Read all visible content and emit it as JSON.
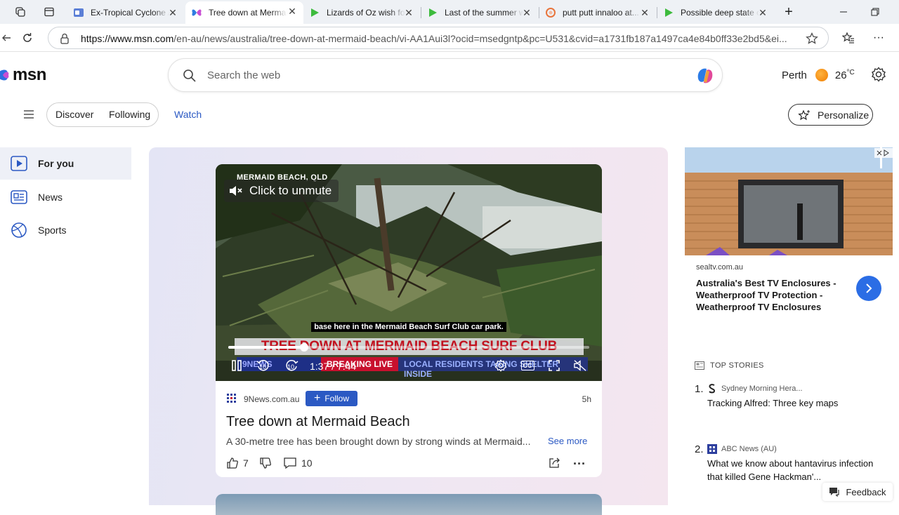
{
  "browser": {
    "tabs": [
      {
        "title": "Ex-Tropical Cyclone A...",
        "icon": "outlook-icon",
        "active": false
      },
      {
        "title": "Tree down at Mermaid Beach",
        "icon": "msn-butterfly-icon",
        "active": true
      },
      {
        "title": "Lizards of Oz wish for...",
        "icon": "play-icon",
        "active": false
      },
      {
        "title": "Last of the summer w...",
        "icon": "play-icon",
        "active": false
      },
      {
        "title": "putt putt innaloo at...",
        "icon": "google-icon",
        "active": false
      },
      {
        "title": "Possible deep state c...",
        "icon": "play-icon",
        "active": false
      }
    ],
    "url_domain": "https://www.msn.com",
    "url_rest": "/en-au/news/australia/tree-down-at-mermaid-beach/vi-AA1Aui3l?ocid=msedgntp&pc=U531&cvid=a1731fb187a1497ca4e84b0ff33e2bd5&ei..."
  },
  "header": {
    "logo": "msn",
    "search_placeholder": "Search the web",
    "location": "Perth",
    "temperature": "26",
    "temp_unit": "°C"
  },
  "nav": {
    "discover": "Discover",
    "following": "Following",
    "watch": "Watch",
    "personalize": "Personalize"
  },
  "sidebar": {
    "items": [
      {
        "label": "For you",
        "icon": "play-square-icon",
        "active": true
      },
      {
        "label": "News",
        "icon": "newspaper-icon",
        "active": false
      },
      {
        "label": "Sports",
        "icon": "ball-icon",
        "active": false
      }
    ]
  },
  "video": {
    "location_chyron": "MERMAID BEACH, QLD",
    "unmute_label": "Click to unmute",
    "caption": "base here in the Mermaid Beach Surf Club car park.",
    "headline": "TREE DOWN AT MERMAID BEACH SURF CLUB",
    "ticker_1": "9NEWS",
    "ticker_2": "BREAKING LIVE",
    "ticker_3": "LOCAL RESIDENTS TAKING SHELTER INSIDE",
    "current_time": "1:37",
    "duration": "7:44",
    "progress": 0.21,
    "skip_seconds": "10",
    "cc": "CC"
  },
  "article": {
    "source": "9News.com.au",
    "follow_label": "Follow",
    "age": "5h",
    "title": "Tree down at Mermaid Beach",
    "snippet": "A 30-metre tree has been brought down by strong winds at Mermaid...",
    "see_more": "See more",
    "likes": "7",
    "comments": "10"
  },
  "ad": {
    "domain": "sealtv.com.au",
    "title": "Australia's Best TV Enclosures - Weatherproof TV Protection - Weatherproof TV Enclosures"
  },
  "top_stories": {
    "heading": "TOP STORIES",
    "items": [
      {
        "num": "1.",
        "source": "Sydney Morning Hera...",
        "title": "Tracking Alfred: Three key maps"
      },
      {
        "num": "2.",
        "source": "ABC News (AU)",
        "title": "What we know about hantavirus infection that killed Gene Hackman'..."
      }
    ]
  },
  "feedback": "Feedback",
  "colors": {
    "accent_blue": "#2b59c3",
    "headline_red": "#c1121f",
    "tab_bar": "#eef1f5"
  }
}
